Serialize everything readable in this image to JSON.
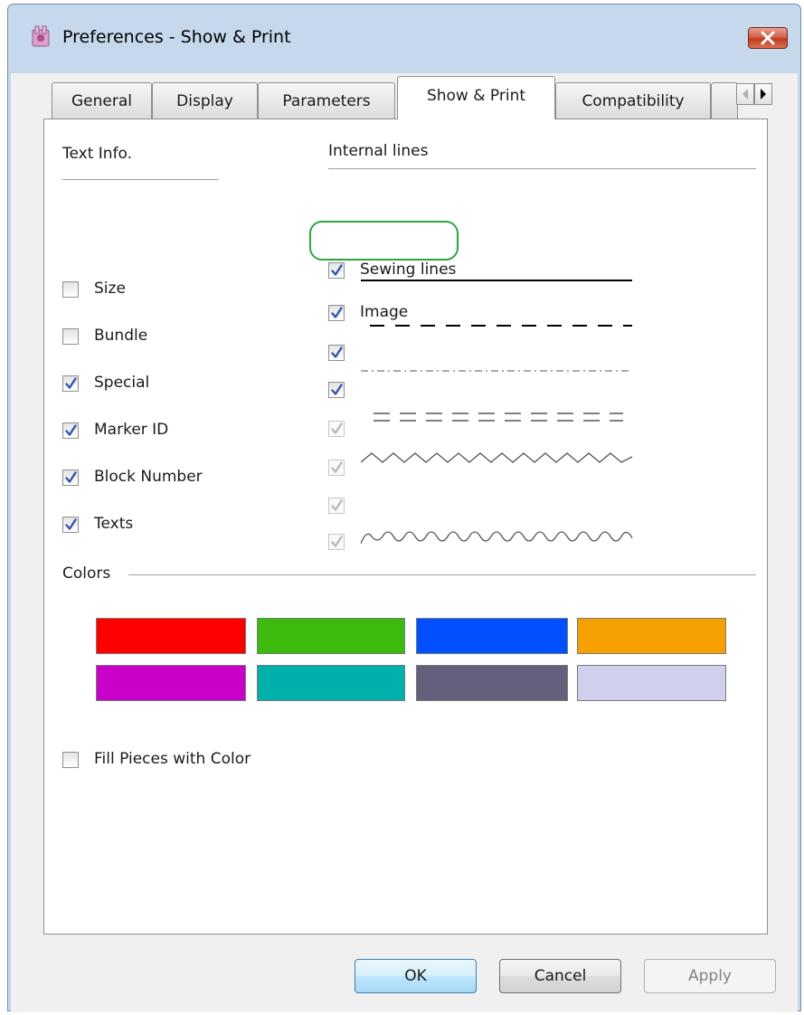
{
  "window": {
    "title": "Preferences - Show & Print"
  },
  "tabs": [
    "General",
    "Display",
    "Parameters",
    "Show & Print",
    "Compatibility"
  ],
  "text_info": {
    "heading": "Text Info.",
    "items": [
      {
        "label": "Size",
        "checked": false
      },
      {
        "label": "Bundle",
        "checked": false
      },
      {
        "label": "Special",
        "checked": true
      },
      {
        "label": "Marker ID",
        "checked": true
      },
      {
        "label": "Block Number",
        "checked": true
      },
      {
        "label": "Texts",
        "checked": true
      }
    ]
  },
  "internal_lines": {
    "heading": "Internal lines",
    "items": [
      {
        "label": "Sewing lines",
        "checked": true,
        "enabled": true
      },
      {
        "label": "Image",
        "checked": true,
        "enabled": true
      }
    ],
    "line_styles": [
      {
        "style": "solid",
        "checked": true,
        "enabled": true
      },
      {
        "style": "dashed",
        "checked": true,
        "enabled": true
      },
      {
        "style": "dash-dot",
        "checked": true,
        "enabled": false
      },
      {
        "style": "double-dashed",
        "checked": true,
        "enabled": false
      },
      {
        "style": "zigzag",
        "checked": true,
        "enabled": false
      },
      {
        "style": "wave",
        "checked": true,
        "enabled": false
      }
    ]
  },
  "colors": {
    "heading": "Colors",
    "swatches": [
      "#ff0000",
      "#3cba0e",
      "#0050ff",
      "#f6a000",
      "#c800c8",
      "#00b0aa",
      "#63607c",
      "#d0d0ec"
    ]
  },
  "fill_pieces": {
    "label": "Fill Pieces with Color",
    "checked": false
  },
  "highlight_color": "#2ea640",
  "buttons": {
    "ok": "OK",
    "cancel": "Cancel",
    "apply": "Apply"
  }
}
